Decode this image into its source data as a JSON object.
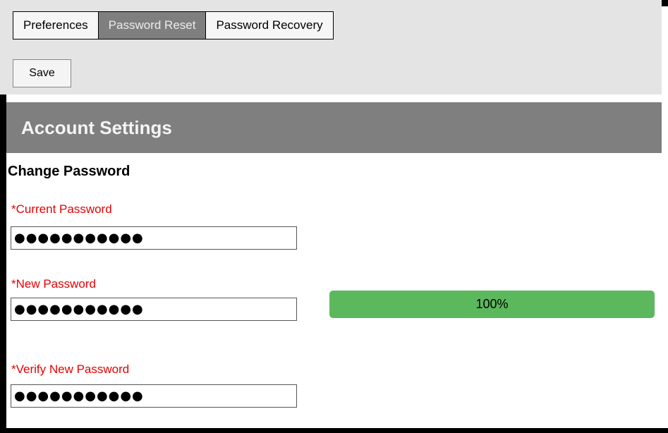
{
  "toolbar": {
    "tabs": [
      {
        "label": "Preferences",
        "active": false
      },
      {
        "label": "Password Reset",
        "active": true
      },
      {
        "label": "Password Recovery",
        "active": false
      }
    ],
    "save_label": "Save"
  },
  "banner": {
    "title": "Account Settings"
  },
  "form": {
    "heading": "Change Password",
    "current_password": {
      "label": "*Current Password",
      "value": "●●●●●●●●●●●"
    },
    "new_password": {
      "label": "*New Password",
      "value": "●●●●●●●●●●●"
    },
    "verify_password": {
      "label": "*Verify New Password",
      "value": "●●●●●●●●●●●"
    },
    "strength": {
      "percent": 100,
      "text": "100%"
    }
  },
  "colors": {
    "required_label": "#e60000",
    "banner_bg": "#7f7f7f",
    "strength_fill": "#5cb85c",
    "active_tab_bg": "#7f7f7f"
  }
}
